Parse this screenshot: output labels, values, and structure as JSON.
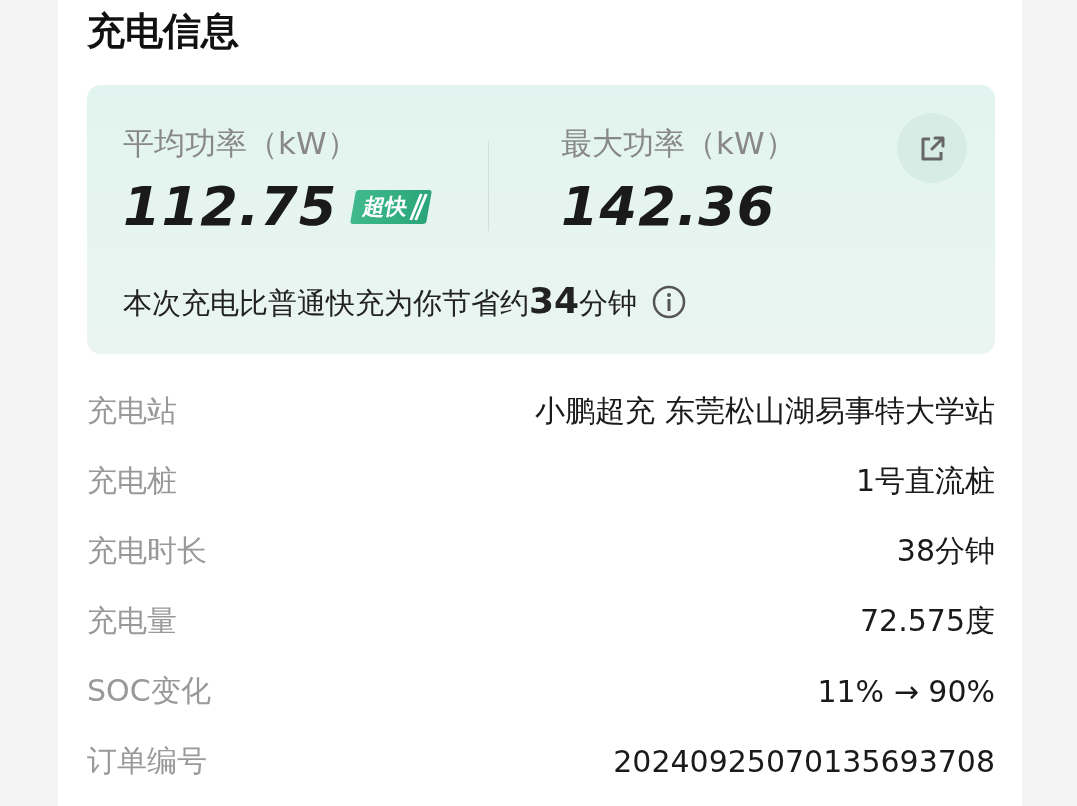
{
  "title": "充电信息",
  "summary": {
    "metrics": [
      {
        "label": "平均功率（kW）",
        "value": "112.75",
        "badge": "超快"
      },
      {
        "label": "最大功率（kW）",
        "value": "142.36"
      }
    ],
    "saving_note": "本次充电比普通快充为你节省约**34**分钟"
  },
  "details": [
    {
      "label": "充电站",
      "value": "小鹏超充 东莞松山湖易事特大学站"
    },
    {
      "label": "充电桩",
      "value": "1号直流桩"
    },
    {
      "label": "充电时长",
      "value": "38分钟"
    },
    {
      "label": "充电量",
      "value": "72.575度"
    },
    {
      "label": "SOC变化",
      "value": "11% → 90%"
    },
    {
      "label": "订单编号",
      "value": "20240925070135693708"
    }
  ]
}
